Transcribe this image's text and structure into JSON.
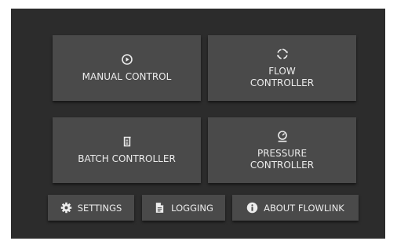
{
  "tiles": {
    "manual": {
      "label": "MANUAL CONTROL",
      "icon": "play-circle-icon"
    },
    "flow": {
      "label": "FLOW CONTROLLER",
      "icon": "circular-arrows-icon"
    },
    "batch": {
      "label": "BATCH CONTROLLER",
      "icon": "beaker-icon"
    },
    "pressure": {
      "label": "PRESSURE CONTROLLER",
      "icon": "gauge-icon"
    }
  },
  "bottom_bar": {
    "settings": {
      "label": "SETTINGS",
      "icon": "gear-icon"
    },
    "logging": {
      "label": "LOGGING",
      "icon": "document-icon"
    },
    "about": {
      "label": "ABOUT FLOWLINK",
      "icon": "info-icon"
    }
  },
  "colors": {
    "background": "#2c2c2c",
    "button": "#4a4a4a",
    "text": "#ececec"
  }
}
